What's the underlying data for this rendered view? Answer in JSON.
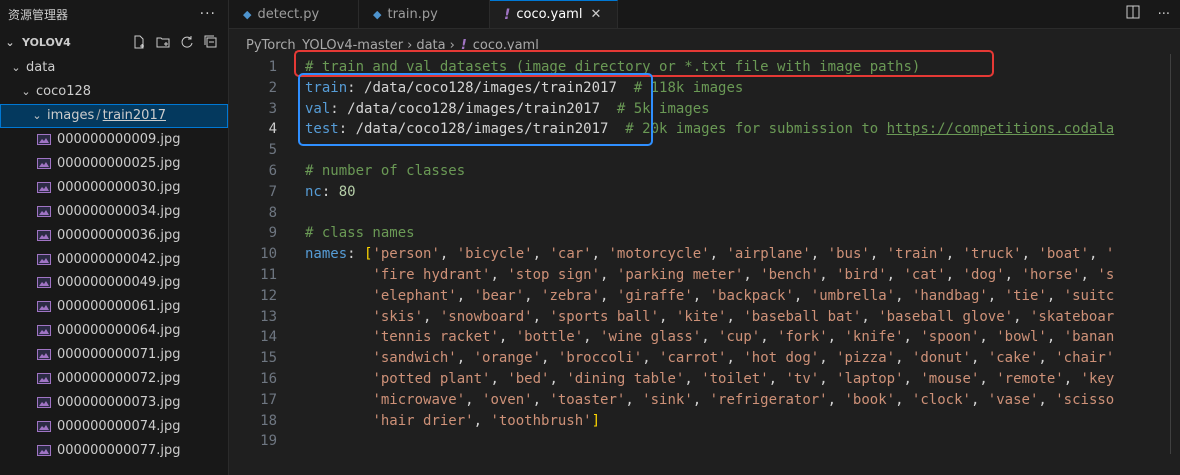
{
  "sidebar": {
    "title": "资源管理器",
    "more": "···",
    "project": "YOLOV4",
    "tree": [
      {
        "label": "data",
        "depth": 0,
        "expanded": true,
        "type": "folder"
      },
      {
        "label": "coco128",
        "depth": 1,
        "expanded": true,
        "type": "folder"
      },
      {
        "label_a": "images",
        "label_sep": "/",
        "label_b": "train2017",
        "depth": 2,
        "expanded": true,
        "type": "folder",
        "selected": true
      },
      {
        "label": "000000000009.jpg",
        "type": "image"
      },
      {
        "label": "000000000025.jpg",
        "type": "image"
      },
      {
        "label": "000000000030.jpg",
        "type": "image"
      },
      {
        "label": "000000000034.jpg",
        "type": "image"
      },
      {
        "label": "000000000036.jpg",
        "type": "image"
      },
      {
        "label": "000000000042.jpg",
        "type": "image"
      },
      {
        "label": "000000000049.jpg",
        "type": "image"
      },
      {
        "label": "000000000061.jpg",
        "type": "image"
      },
      {
        "label": "000000000064.jpg",
        "type": "image"
      },
      {
        "label": "000000000071.jpg",
        "type": "image"
      },
      {
        "label": "000000000072.jpg",
        "type": "image"
      },
      {
        "label": "000000000073.jpg",
        "type": "image"
      },
      {
        "label": "000000000074.jpg",
        "type": "image"
      },
      {
        "label": "000000000077.jpg",
        "type": "image"
      }
    ]
  },
  "tabs": [
    {
      "label": "detect.py",
      "icon": "python-icon",
      "active": false
    },
    {
      "label": "train.py",
      "icon": "python-icon",
      "active": false
    },
    {
      "label": "coco.yaml",
      "icon": "yaml-icon",
      "active": true,
      "close": "✕"
    }
  ],
  "breadcrumb": [
    "PyTorch_YOLOv4-master",
    "data",
    "coco.yaml"
  ],
  "editor": {
    "lines": [
      [
        {
          "t": "# train and val datasets (image directory or *.txt file with image paths)",
          "c": "comment"
        }
      ],
      [
        {
          "t": "train",
          "c": "key"
        },
        {
          "t": ": ",
          "c": "punc"
        },
        {
          "t": "/data/coco128/images/train2017",
          "c": "plain"
        },
        {
          "t": "  # 118k images",
          "c": "comment"
        }
      ],
      [
        {
          "t": "val",
          "c": "key"
        },
        {
          "t": ": ",
          "c": "punc"
        },
        {
          "t": "/data/coco128/images/train2017",
          "c": "plain"
        },
        {
          "t": "  # 5k images",
          "c": "comment"
        }
      ],
      [
        {
          "t": "test",
          "c": "key"
        },
        {
          "t": ": ",
          "c": "punc"
        },
        {
          "t": "/data/coco128/images/train2017",
          "c": "plain"
        },
        {
          "t": "  # 20k images for submission to ",
          "c": "comment"
        },
        {
          "t": "https://competitions.codala",
          "c": "link"
        }
      ],
      [],
      [
        {
          "t": "# number of classes",
          "c": "comment"
        }
      ],
      [
        {
          "t": "nc",
          "c": "key"
        },
        {
          "t": ": ",
          "c": "punc"
        },
        {
          "t": "80",
          "c": "num"
        }
      ],
      [],
      [
        {
          "t": "# class names",
          "c": "comment"
        }
      ],
      [
        {
          "t": "names",
          "c": "key"
        },
        {
          "t": ": ",
          "c": "punc"
        },
        {
          "t": "[",
          "c": "bracket"
        },
        {
          "t": "'person'",
          "c": "str"
        },
        {
          "t": ", ",
          "c": "punc"
        },
        {
          "t": "'bicycle'",
          "c": "str"
        },
        {
          "t": ", ",
          "c": "punc"
        },
        {
          "t": "'car'",
          "c": "str"
        },
        {
          "t": ", ",
          "c": "punc"
        },
        {
          "t": "'motorcycle'",
          "c": "str"
        },
        {
          "t": ", ",
          "c": "punc"
        },
        {
          "t": "'airplane'",
          "c": "str"
        },
        {
          "t": ", ",
          "c": "punc"
        },
        {
          "t": "'bus'",
          "c": "str"
        },
        {
          "t": ", ",
          "c": "punc"
        },
        {
          "t": "'train'",
          "c": "str"
        },
        {
          "t": ", ",
          "c": "punc"
        },
        {
          "t": "'truck'",
          "c": "str"
        },
        {
          "t": ", ",
          "c": "punc"
        },
        {
          "t": "'boat'",
          "c": "str"
        },
        {
          "t": ", ",
          "c": "punc"
        },
        {
          "t": "'",
          "c": "str"
        }
      ],
      [
        {
          "t": "        ",
          "c": "plain"
        },
        {
          "t": "'fire hydrant'",
          "c": "str"
        },
        {
          "t": ", ",
          "c": "punc"
        },
        {
          "t": "'stop sign'",
          "c": "str"
        },
        {
          "t": ", ",
          "c": "punc"
        },
        {
          "t": "'parking meter'",
          "c": "str"
        },
        {
          "t": ", ",
          "c": "punc"
        },
        {
          "t": "'bench'",
          "c": "str"
        },
        {
          "t": ", ",
          "c": "punc"
        },
        {
          "t": "'bird'",
          "c": "str"
        },
        {
          "t": ", ",
          "c": "punc"
        },
        {
          "t": "'cat'",
          "c": "str"
        },
        {
          "t": ", ",
          "c": "punc"
        },
        {
          "t": "'dog'",
          "c": "str"
        },
        {
          "t": ", ",
          "c": "punc"
        },
        {
          "t": "'horse'",
          "c": "str"
        },
        {
          "t": ", ",
          "c": "punc"
        },
        {
          "t": "'s",
          "c": "str"
        }
      ],
      [
        {
          "t": "        ",
          "c": "plain"
        },
        {
          "t": "'elephant'",
          "c": "str"
        },
        {
          "t": ", ",
          "c": "punc"
        },
        {
          "t": "'bear'",
          "c": "str"
        },
        {
          "t": ", ",
          "c": "punc"
        },
        {
          "t": "'zebra'",
          "c": "str"
        },
        {
          "t": ", ",
          "c": "punc"
        },
        {
          "t": "'giraffe'",
          "c": "str"
        },
        {
          "t": ", ",
          "c": "punc"
        },
        {
          "t": "'backpack'",
          "c": "str"
        },
        {
          "t": ", ",
          "c": "punc"
        },
        {
          "t": "'umbrella'",
          "c": "str"
        },
        {
          "t": ", ",
          "c": "punc"
        },
        {
          "t": "'handbag'",
          "c": "str"
        },
        {
          "t": ", ",
          "c": "punc"
        },
        {
          "t": "'tie'",
          "c": "str"
        },
        {
          "t": ", ",
          "c": "punc"
        },
        {
          "t": "'suitc",
          "c": "str"
        }
      ],
      [
        {
          "t": "        ",
          "c": "plain"
        },
        {
          "t": "'skis'",
          "c": "str"
        },
        {
          "t": ", ",
          "c": "punc"
        },
        {
          "t": "'snowboard'",
          "c": "str"
        },
        {
          "t": ", ",
          "c": "punc"
        },
        {
          "t": "'sports ball'",
          "c": "str"
        },
        {
          "t": ", ",
          "c": "punc"
        },
        {
          "t": "'kite'",
          "c": "str"
        },
        {
          "t": ", ",
          "c": "punc"
        },
        {
          "t": "'baseball bat'",
          "c": "str"
        },
        {
          "t": ", ",
          "c": "punc"
        },
        {
          "t": "'baseball glove'",
          "c": "str"
        },
        {
          "t": ", ",
          "c": "punc"
        },
        {
          "t": "'skateboar",
          "c": "str"
        }
      ],
      [
        {
          "t": "        ",
          "c": "plain"
        },
        {
          "t": "'tennis racket'",
          "c": "str"
        },
        {
          "t": ", ",
          "c": "punc"
        },
        {
          "t": "'bottle'",
          "c": "str"
        },
        {
          "t": ", ",
          "c": "punc"
        },
        {
          "t": "'wine glass'",
          "c": "str"
        },
        {
          "t": ", ",
          "c": "punc"
        },
        {
          "t": "'cup'",
          "c": "str"
        },
        {
          "t": ", ",
          "c": "punc"
        },
        {
          "t": "'fork'",
          "c": "str"
        },
        {
          "t": ", ",
          "c": "punc"
        },
        {
          "t": "'knife'",
          "c": "str"
        },
        {
          "t": ", ",
          "c": "punc"
        },
        {
          "t": "'spoon'",
          "c": "str"
        },
        {
          "t": ", ",
          "c": "punc"
        },
        {
          "t": "'bowl'",
          "c": "str"
        },
        {
          "t": ", ",
          "c": "punc"
        },
        {
          "t": "'banan",
          "c": "str"
        }
      ],
      [
        {
          "t": "        ",
          "c": "plain"
        },
        {
          "t": "'sandwich'",
          "c": "str"
        },
        {
          "t": ", ",
          "c": "punc"
        },
        {
          "t": "'orange'",
          "c": "str"
        },
        {
          "t": ", ",
          "c": "punc"
        },
        {
          "t": "'broccoli'",
          "c": "str"
        },
        {
          "t": ", ",
          "c": "punc"
        },
        {
          "t": "'carrot'",
          "c": "str"
        },
        {
          "t": ", ",
          "c": "punc"
        },
        {
          "t": "'hot dog'",
          "c": "str"
        },
        {
          "t": ", ",
          "c": "punc"
        },
        {
          "t": "'pizza'",
          "c": "str"
        },
        {
          "t": ", ",
          "c": "punc"
        },
        {
          "t": "'donut'",
          "c": "str"
        },
        {
          "t": ", ",
          "c": "punc"
        },
        {
          "t": "'cake'",
          "c": "str"
        },
        {
          "t": ", ",
          "c": "punc"
        },
        {
          "t": "'chair'",
          "c": "str"
        }
      ],
      [
        {
          "t": "        ",
          "c": "plain"
        },
        {
          "t": "'potted plant'",
          "c": "str"
        },
        {
          "t": ", ",
          "c": "punc"
        },
        {
          "t": "'bed'",
          "c": "str"
        },
        {
          "t": ", ",
          "c": "punc"
        },
        {
          "t": "'dining table'",
          "c": "str"
        },
        {
          "t": ", ",
          "c": "punc"
        },
        {
          "t": "'toilet'",
          "c": "str"
        },
        {
          "t": ", ",
          "c": "punc"
        },
        {
          "t": "'tv'",
          "c": "str"
        },
        {
          "t": ", ",
          "c": "punc"
        },
        {
          "t": "'laptop'",
          "c": "str"
        },
        {
          "t": ", ",
          "c": "punc"
        },
        {
          "t": "'mouse'",
          "c": "str"
        },
        {
          "t": ", ",
          "c": "punc"
        },
        {
          "t": "'remote'",
          "c": "str"
        },
        {
          "t": ", ",
          "c": "punc"
        },
        {
          "t": "'key",
          "c": "str"
        }
      ],
      [
        {
          "t": "        ",
          "c": "plain"
        },
        {
          "t": "'microwave'",
          "c": "str"
        },
        {
          "t": ", ",
          "c": "punc"
        },
        {
          "t": "'oven'",
          "c": "str"
        },
        {
          "t": ", ",
          "c": "punc"
        },
        {
          "t": "'toaster'",
          "c": "str"
        },
        {
          "t": ", ",
          "c": "punc"
        },
        {
          "t": "'sink'",
          "c": "str"
        },
        {
          "t": ", ",
          "c": "punc"
        },
        {
          "t": "'refrigerator'",
          "c": "str"
        },
        {
          "t": ", ",
          "c": "punc"
        },
        {
          "t": "'book'",
          "c": "str"
        },
        {
          "t": ", ",
          "c": "punc"
        },
        {
          "t": "'clock'",
          "c": "str"
        },
        {
          "t": ", ",
          "c": "punc"
        },
        {
          "t": "'vase'",
          "c": "str"
        },
        {
          "t": ", ",
          "c": "punc"
        },
        {
          "t": "'scisso",
          "c": "str"
        }
      ],
      [
        {
          "t": "        ",
          "c": "plain"
        },
        {
          "t": "'hair drier'",
          "c": "str"
        },
        {
          "t": ", ",
          "c": "punc"
        },
        {
          "t": "'toothbrush'",
          "c": "str"
        },
        {
          "t": "]",
          "c": "bracket"
        }
      ],
      []
    ],
    "current_line": 4
  },
  "colors": {
    "accent": "#0078d4",
    "highlight_red": "#e53935",
    "highlight_blue": "#2f8fff"
  }
}
